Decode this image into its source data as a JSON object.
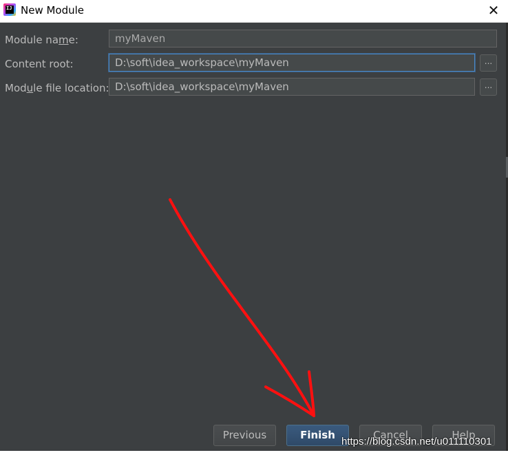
{
  "window": {
    "title": "New Module",
    "app_icon_text": "IJ",
    "close_symbol": "✕"
  },
  "fields": {
    "module_name": {
      "label_pre": "Module na",
      "label_mnemonic": "m",
      "label_post": "e:",
      "value": "myMaven"
    },
    "content_root": {
      "label": "Content root:",
      "value": "D:\\soft\\idea_workspace\\myMaven",
      "browse_label": "..."
    },
    "module_file_location": {
      "label_pre": "Mod",
      "label_mnemonic": "u",
      "label_post": "le file location:",
      "value": "D:\\soft\\idea_workspace\\myMaven",
      "browse_label": "..."
    }
  },
  "buttons": {
    "previous": "Previous",
    "finish": "Finish",
    "cancel": "Cancel",
    "help": "Help"
  },
  "watermark": "https://blog.csdn.net/u011110301",
  "colors": {
    "background": "#3c3f41",
    "text": "#bbbbbb",
    "focus": "#4a88c7",
    "primary_button": "#365880",
    "annotation_arrow": "#ff0000"
  }
}
